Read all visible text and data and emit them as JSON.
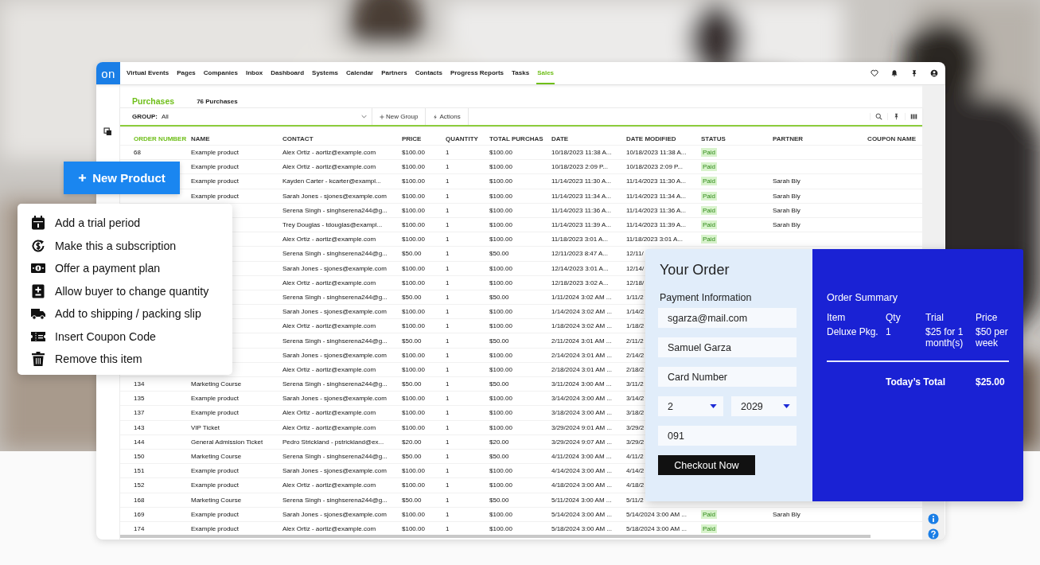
{
  "nav": {
    "logo": "on",
    "items": [
      {
        "label": "Virtual Events",
        "selected": false
      },
      {
        "label": "Pages",
        "selected": false
      },
      {
        "label": "Companies",
        "selected": false
      },
      {
        "label": "Inbox",
        "selected": false
      },
      {
        "label": "Dashboard",
        "selected": false
      },
      {
        "label": "Systems",
        "selected": false
      },
      {
        "label": "Calendar",
        "selected": false
      },
      {
        "label": "Partners",
        "selected": false
      },
      {
        "label": "Contacts",
        "selected": false
      },
      {
        "label": "Progress Reports",
        "selected": false
      },
      {
        "label": "Tasks",
        "selected": false
      },
      {
        "label": "Sales",
        "selected": true
      }
    ]
  },
  "page": {
    "title": "Purchases",
    "count": "76 Purchases"
  },
  "toolbar": {
    "group_label": "GROUP:",
    "group_value": "All",
    "new_group": "New Group",
    "actions": "Actions"
  },
  "table": {
    "columns": [
      "ORDER NUMBER",
      "NAME",
      "CONTACT",
      "PRICE",
      "QUANTITY",
      "TOTAL PURCHAS",
      "DATE",
      "DATE MODIFIED",
      "STATUS",
      "PARTNER",
      "COUPON NAME"
    ],
    "rows": [
      {
        "order": "68",
        "name": "Example product",
        "contact": "Alex Ortiz - aortiz@example.com",
        "price": "$100.00",
        "quantity": "1",
        "total": "$100.00",
        "date": "10/18/2023 11:38 A...",
        "modified": "10/18/2023 11:38 A...",
        "status": "Paid"
      },
      {
        "name": "Example product",
        "contact": "Alex Ortiz - aortiz@example.com",
        "price": "$100.00",
        "quantity": "1",
        "total": "$100.00",
        "date": "10/18/2023 2:09 P...",
        "modified": "10/18/2023 2:09 P...",
        "status": "Paid"
      },
      {
        "name": "Example product",
        "contact": "Kayden Carter - kcarter@exampl...",
        "price": "$100.00",
        "quantity": "1",
        "total": "$100.00",
        "date": "11/14/2023 11:30 A...",
        "modified": "11/14/2023 11:30 A...",
        "status": "Paid",
        "partner": "Sarah Bly"
      },
      {
        "name": "Example product",
        "contact": "Sarah Jones - sjones@example.com",
        "price": "$100.00",
        "quantity": "1",
        "total": "$100.00",
        "date": "11/14/2023 11:34 A...",
        "modified": "11/14/2023 11:34 A...",
        "status": "Paid",
        "partner": "Sarah Bly"
      },
      {
        "contact": "Serena Singh - singhserena244@g...",
        "price": "$100.00",
        "quantity": "1",
        "total": "$100.00",
        "date": "11/14/2023 11:36 A...",
        "modified": "11/14/2023 11:36 A...",
        "status": "Paid",
        "partner": "Sarah Bly"
      },
      {
        "contact": "Trey Douglas - tdouglas@exampl...",
        "price": "$100.00",
        "quantity": "1",
        "total": "$100.00",
        "date": "11/14/2023 11:39 A...",
        "modified": "11/14/2023 11:39 A...",
        "status": "Paid",
        "partner": "Sarah Bly"
      },
      {
        "contact": "Alex Ortiz - aortiz@example.com",
        "price": "$100.00",
        "quantity": "1",
        "total": "$100.00",
        "date": "11/18/2023 3:01 A...",
        "modified": "11/18/2023 3:01 A...",
        "status": "Paid"
      },
      {
        "contact": "Serena Singh - singhserena244@g...",
        "price": "$50.00",
        "quantity": "1",
        "total": "$50.00",
        "date": "12/11/2023 8:47 A...",
        "modified": "12/11/"
      },
      {
        "contact": "Sarah Jones - sjones@example.com",
        "price": "$100.00",
        "quantity": "1",
        "total": "$100.00",
        "date": "12/14/2023 3:01 A...",
        "modified": "12/14/"
      },
      {
        "contact": "Alex Ortiz - aortiz@example.com",
        "price": "$100.00",
        "quantity": "1",
        "total": "$100.00",
        "date": "12/18/2023 3:02 A...",
        "modified": "12/18/"
      },
      {
        "contact": "Serena Singh - singhserena244@g...",
        "price": "$50.00",
        "quantity": "1",
        "total": "$50.00",
        "date": "1/11/2024 3:02 AM ...",
        "modified": "1/11/2"
      },
      {
        "contact": "Sarah Jones - sjones@example.com",
        "price": "$100.00",
        "quantity": "1",
        "total": "$100.00",
        "date": "1/14/2024 3:02 AM ...",
        "modified": "1/14/2"
      },
      {
        "contact": "Alex Ortiz - aortiz@example.com",
        "price": "$100.00",
        "quantity": "1",
        "total": "$100.00",
        "date": "1/18/2024 3:02 AM ...",
        "modified": "1/18/2"
      },
      {
        "contact": "Serena Singh - singhserena244@g...",
        "price": "$50.00",
        "quantity": "1",
        "total": "$50.00",
        "date": "2/11/2024 3:01 AM ...",
        "modified": "2/11/2"
      },
      {
        "contact": "Sarah Jones - sjones@example.com",
        "price": "$100.00",
        "quantity": "1",
        "total": "$100.00",
        "date": "2/14/2024 3:01 AM ...",
        "modified": "2/14/2"
      },
      {
        "contact": "Alex Ortiz - aortiz@example.com",
        "price": "$100.00",
        "quantity": "1",
        "total": "$100.00",
        "date": "2/18/2024 3:01 AM ...",
        "modified": "2/18/2"
      },
      {
        "order": "134",
        "name": "Marketing Course",
        "contact": "Serena Singh - singhserena244@g...",
        "price": "$50.00",
        "quantity": "1",
        "total": "$50.00",
        "date": "3/11/2024 3:00 AM ...",
        "modified": "3/11/2"
      },
      {
        "order": "135",
        "name": "Example product",
        "contact": "Sarah Jones - sjones@example.com",
        "price": "$100.00",
        "quantity": "1",
        "total": "$100.00",
        "date": "3/14/2024 3:00 AM ...",
        "modified": "3/14/2"
      },
      {
        "order": "137",
        "name": "Example product",
        "contact": "Alex Ortiz - aortiz@example.com",
        "price": "$100.00",
        "quantity": "1",
        "total": "$100.00",
        "date": "3/18/2024 3:00 AM ...",
        "modified": "3/18/2"
      },
      {
        "order": "143",
        "name": "VIP Ticket",
        "contact": "Alex Ortiz - aortiz@example.com",
        "price": "$100.00",
        "quantity": "1",
        "total": "$100.00",
        "date": "3/29/2024 9:01 AM ...",
        "modified": "3/29/2"
      },
      {
        "order": "144",
        "name": "General Admission Ticket",
        "contact": "Pedro Strickland - pstrickland@ex...",
        "price": "$20.00",
        "quantity": "1",
        "total": "$20.00",
        "date": "3/29/2024 9:07 AM ...",
        "modified": "3/29/2"
      },
      {
        "order": "150",
        "name": "Marketing Course",
        "contact": "Serena Singh - singhserena244@g...",
        "price": "$50.00",
        "quantity": "1",
        "total": "$50.00",
        "date": "4/11/2024 3:00 AM ...",
        "modified": "4/11/2"
      },
      {
        "order": "151",
        "name": "Example product",
        "contact": "Sarah Jones - sjones@example.com",
        "price": "$100.00",
        "quantity": "1",
        "total": "$100.00",
        "date": "4/14/2024 3:00 AM ...",
        "modified": "4/14/2"
      },
      {
        "order": "152",
        "name": "Example product",
        "contact": "Alex Ortiz - aortiz@example.com",
        "price": "$100.00",
        "quantity": "1",
        "total": "$100.00",
        "date": "4/18/2024 3:00 AM ...",
        "modified": "4/18/2"
      },
      {
        "order": "168",
        "name": "Marketing Course",
        "contact": "Serena Singh - singhserena244@g...",
        "price": "$50.00",
        "quantity": "1",
        "total": "$50.00",
        "date": "5/11/2024 3:00 AM ...",
        "modified": "5/11/2"
      },
      {
        "order": "169",
        "name": "Example product",
        "contact": "Sarah Jones - sjones@example.com",
        "price": "$100.00",
        "quantity": "1",
        "total": "$100.00",
        "date": "5/14/2024 3:00 AM ...",
        "modified": "5/14/2024 3:00 AM ...",
        "status": "Paid",
        "partner": "Sarah Bly"
      },
      {
        "order": "174",
        "name": "Example product",
        "contact": "Alex Ortiz - aortiz@example.com",
        "price": "$100.00",
        "quantity": "1",
        "total": "$100.00",
        "date": "5/18/2024 3:00 AM ...",
        "modified": "5/18/2024 3:00 AM ...",
        "status": "Paid"
      }
    ]
  },
  "new_product": {
    "label": "New Product"
  },
  "menu": [
    {
      "label": "Add a trial period"
    },
    {
      "label": "Make this a subscription"
    },
    {
      "label": "Offer a payment plan"
    },
    {
      "label": "Allow buyer to change quantity"
    },
    {
      "label": "Add to shipping / packing slip"
    },
    {
      "label": "Insert Coupon Code"
    },
    {
      "label": "Remove this item"
    }
  ],
  "order": {
    "title": "Your Order",
    "section": "Payment Information",
    "fields": [
      {
        "value": "sgarza@mail.com"
      },
      {
        "value": "Samuel Garza"
      },
      {
        "placeholder": "Card Number"
      }
    ],
    "selects": [
      {
        "value": "2"
      },
      {
        "value": "2029"
      }
    ],
    "cvv": {
      "value": "091"
    },
    "button": "Checkout Now"
  },
  "summary": {
    "title": "Order Summary",
    "columns": [
      "Item",
      "Qty",
      "Trial",
      "Price"
    ],
    "rows": [
      {
        "item": "Deluxe Pkg.",
        "qty": "1",
        "trial": "$25 for 1 month(s)",
        "price": "$50 per week"
      }
    ],
    "total_label": "Today’s Total",
    "total": "$25.00"
  }
}
